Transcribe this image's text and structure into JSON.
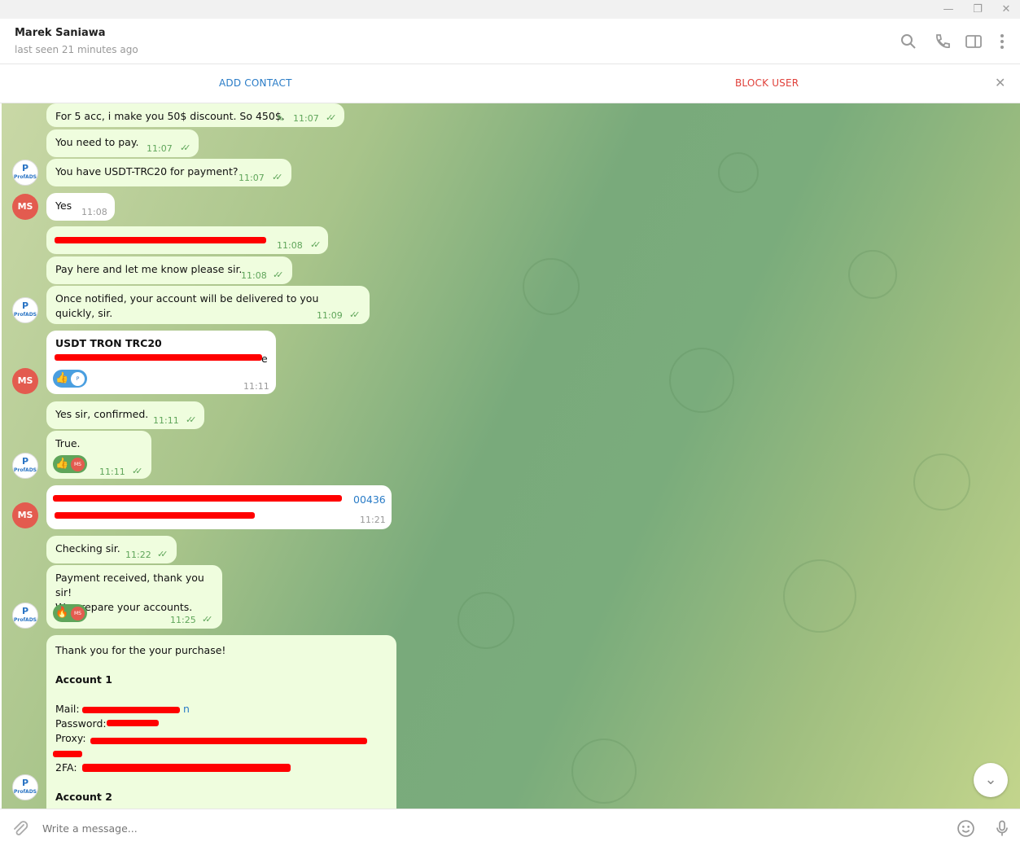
{
  "window": {
    "minimize": "—",
    "restore": "❐",
    "close": "✕"
  },
  "header": {
    "name": "Marek Saniawa",
    "status": "last seen 21 minutes ago"
  },
  "actions": {
    "add_contact": "ADD CONTACT",
    "block_user": "BLOCK USER",
    "close": "✕"
  },
  "avatars": {
    "ms": "MS",
    "profads": "ProfADS"
  },
  "messages": {
    "m1": {
      "text": "For 5 acc, i make you 50$ discount. So 450$.",
      "time": "11:07",
      "edit_icon": "✎"
    },
    "m2": {
      "text": "You need to pay.",
      "time": "11:07"
    },
    "m3": {
      "text": "You have USDT-TRC20 for payment?",
      "time": "11:07"
    },
    "m4": {
      "text": "Yes",
      "time": "11:08"
    },
    "m5": {
      "time": "11:08"
    },
    "m6": {
      "text": "Pay here and let me know please sir.",
      "time": "11:08"
    },
    "m7": {
      "text": "Once notified, your account will be delivered to you quickly, sir.",
      "time": "11:09"
    },
    "m8": {
      "title": "USDT TRON TRC20",
      "tail": "e",
      "time": "11:11",
      "reaction": "👍"
    },
    "m9": {
      "text": "Yes sir, confirmed.",
      "time": "11:11"
    },
    "m10": {
      "text": "True.",
      "time": "11:11",
      "reaction": "👍"
    },
    "m11": {
      "line1_tail": "00436",
      "time": "11:21"
    },
    "m12": {
      "text": "Checking sir.",
      "time": "11:22"
    },
    "m13": {
      "line1": "Payment received, thank you sir!",
      "line2": "We prepare your accounts.",
      "time": "11:25",
      "reaction": "🔥"
    },
    "m14": {
      "intro": "Thank you for the your purchase!",
      "account1": "Account 1",
      "mail_label": "Mail:",
      "mail_tail": "n",
      "password_label": "Password:",
      "proxy_label": "Proxy:",
      "twofa_label": "2FA:",
      "account2": "Account 2"
    }
  },
  "composer": {
    "placeholder": "Write a message..."
  },
  "scroll_down": "⌄",
  "colors": {
    "outgoing": "#effdde",
    "incoming": "#ffffff",
    "accent": "#2a7cc7",
    "danger": "#e0403a",
    "check": "#5fa55a"
  }
}
